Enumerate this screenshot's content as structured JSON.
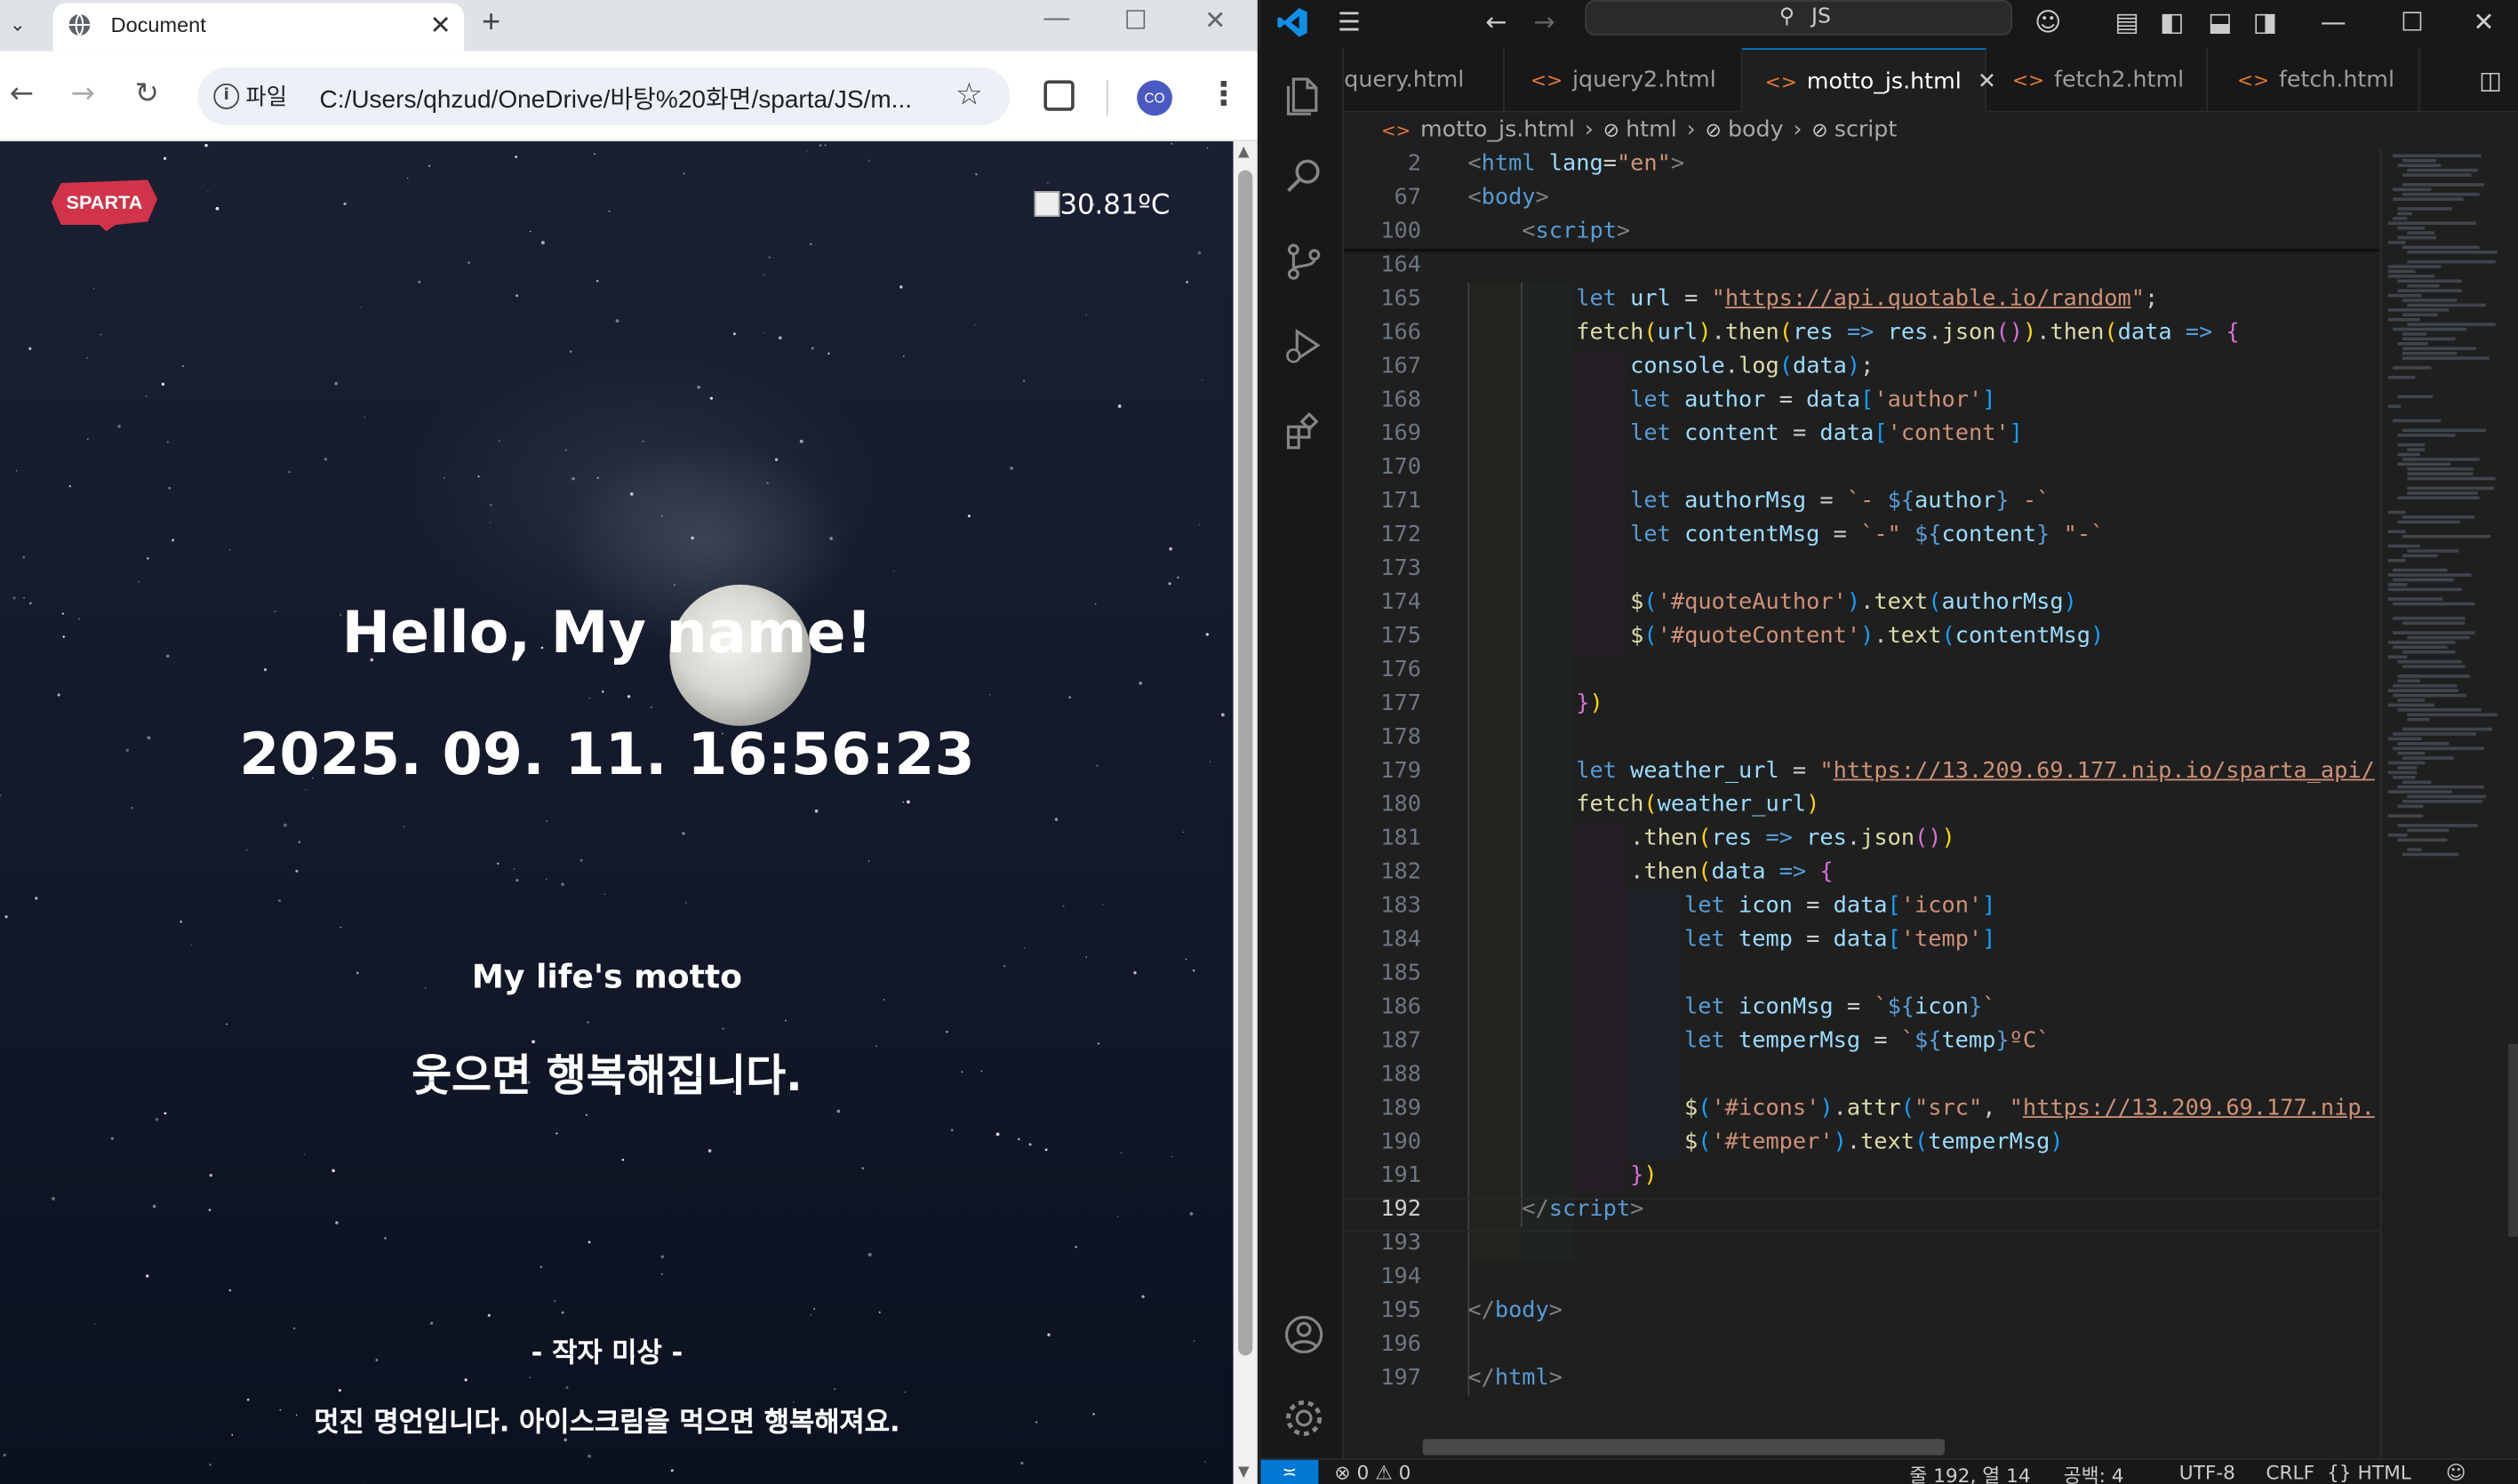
{
  "browser": {
    "tab_title": "Document",
    "address_chip": "파일",
    "url": "C:/Users/qhzud/OneDrive/바탕%20화면/sparta/JS/m...",
    "profile_initials": "CO"
  },
  "page": {
    "logo_text": "SPARTA",
    "temperature": "30.81ºC",
    "greeting": "Hello, My name!",
    "datetime": "2025. 09. 11. 16:56:23",
    "motto_title": "My life's motto",
    "motto": "웃으면 행복해집니다.",
    "quote_author": "- 작자 미상 -",
    "quote_content": "멋진 명언입니다. 아이스크림을 먹으면 행복해져요."
  },
  "vscode": {
    "search_text": "JS",
    "tabs": [
      {
        "label": "query.html"
      },
      {
        "label": "jquery2.html"
      },
      {
        "label": "motto_js.html"
      },
      {
        "label": "fetch2.html"
      },
      {
        "label": "fetch.html"
      }
    ],
    "breadcrumb": [
      "motto_js.html",
      "html",
      "body",
      "script"
    ],
    "status": {
      "errors": "0",
      "warnings": "0",
      "position": "줄 192, 열 14",
      "spaces": "공백: 4",
      "encoding": "UTF-8",
      "eol": "CRLF",
      "language": "HTML"
    }
  },
  "colors": {
    "vscode_accent": "#0078d4",
    "html_icon": "#e37933",
    "logo_red": "#d1344a"
  }
}
